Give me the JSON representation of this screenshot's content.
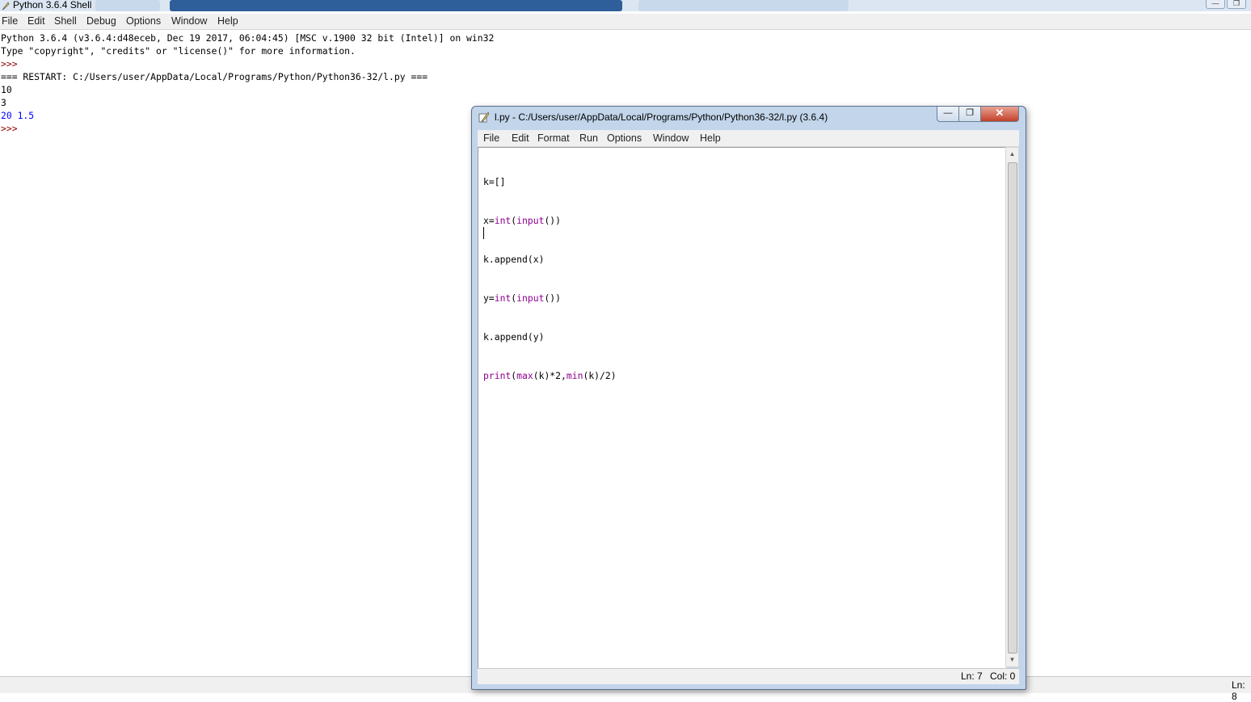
{
  "shell": {
    "title": "Python 3.6.4 Shell",
    "menu": [
      "File",
      "Edit",
      "Shell",
      "Debug",
      "Options",
      "Window",
      "Help"
    ],
    "lines": {
      "banner1": "Python 3.6.4 (v3.6.4:d48eceb, Dec 19 2017, 06:04:45) [MSC v.1900 32 bit (Intel)] on win32",
      "banner2": "Type \"copyright\", \"credits\" or \"license()\" for more information.",
      "prompt": ">>>",
      "restart": "=== RESTART: C:/Users/user/AppData/Local/Programs/Python/Python36-32/l.py ===",
      "input1": "10",
      "input2": "3",
      "output": "20 1.5"
    },
    "status": "Ln: 8"
  },
  "editor": {
    "title": "l.py - C:/Users/user/AppData/Local/Programs/Python/Python36-32/l.py (3.6.4)",
    "menu": [
      "File",
      "Edit",
      "Format",
      "Run",
      "Options",
      "Window",
      "Help"
    ],
    "code": {
      "l1": "k=[]",
      "l2_a": "x=",
      "l2_kw1": "int",
      "l2_b": "(",
      "l2_kw2": "input",
      "l2_c": "())",
      "l3": "k.append(x)",
      "l4_a": "y=",
      "l4_kw1": "int",
      "l4_b": "(",
      "l4_kw2": "input",
      "l4_c": "())",
      "l5": "k.append(y)",
      "l6_kw1": "print",
      "l6_a": "(",
      "l6_kw2": "max",
      "l6_b": "(k)*2,",
      "l6_kw3": "min",
      "l6_c": "(k)/2)"
    },
    "status": {
      "line": "Ln: 7",
      "col": "Col: 0"
    },
    "controls": {
      "minimize": "—",
      "maximize": "❐",
      "close": "✕"
    }
  },
  "colors": {
    "keyword": "#900090",
    "prompt": "#8b0000",
    "output": "#0000ff",
    "titlebar": "#c2d5ea"
  }
}
